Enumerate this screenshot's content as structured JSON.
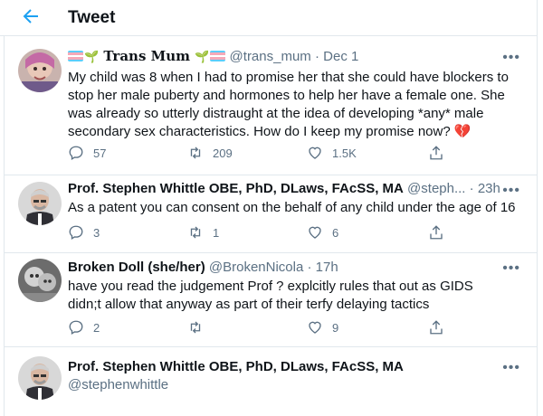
{
  "header": {
    "title": "Tweet",
    "back_icon": "arrow-left-icon",
    "accent": "#1da1f2"
  },
  "tweets": [
    {
      "name": "Trans Mum",
      "name_prefix_icons": [
        "trans-flag-icon",
        "seedling-icon"
      ],
      "name_suffix_icons": [
        "seedling-icon",
        "trans-flag-icon"
      ],
      "handle": "@trans_mum",
      "separator": "·",
      "time": "Dec 1",
      "more": "•••",
      "text_lines": [
        "My child was 8 when I had to promise her that she could have blockers to",
        "stop her male puberty and hormones to help her have a female one.  She",
        "was already so utterly distraught at the idea of developing *any* male",
        "secondary sex characteristics.  How do I keep my promise now?"
      ],
      "text_end_icon": "broken-heart-icon",
      "text_end_glyph": "💔",
      "replies": "57",
      "retweets": "209",
      "likes": "1.5K"
    },
    {
      "name": "Prof. Stephen Whittle OBE, PhD, DLaws, FAcSS, MA",
      "handle": "@steph...",
      "separator": "·",
      "time": "23h",
      "more": "•••",
      "text_lines": [
        "As a patent you can consent on the behalf of any child under the age of 16"
      ],
      "replies": "3",
      "retweets": "1",
      "likes": "6"
    },
    {
      "name": "Broken Doll (she/her)",
      "handle": "@BrokenNicola",
      "separator": "·",
      "time": "17h",
      "more": "•••",
      "text_lines": [
        "have you  read the  judgement  Prof ?  explcitly  rules that out as GIDS",
        "didn;t allow that anyway   as part of their terfy delaying tactics"
      ],
      "replies": "2",
      "retweets": "",
      "likes": "9"
    },
    {
      "name": "Prof. Stephen Whittle OBE, PhD, DLaws, FAcSS, MA",
      "handle": "@stephenwhittle",
      "more": "•••"
    }
  ],
  "colors": {
    "text": "#0f1419",
    "muted": "#5b7083",
    "border": "#e1e8ed",
    "heart": "#e0245e"
  }
}
